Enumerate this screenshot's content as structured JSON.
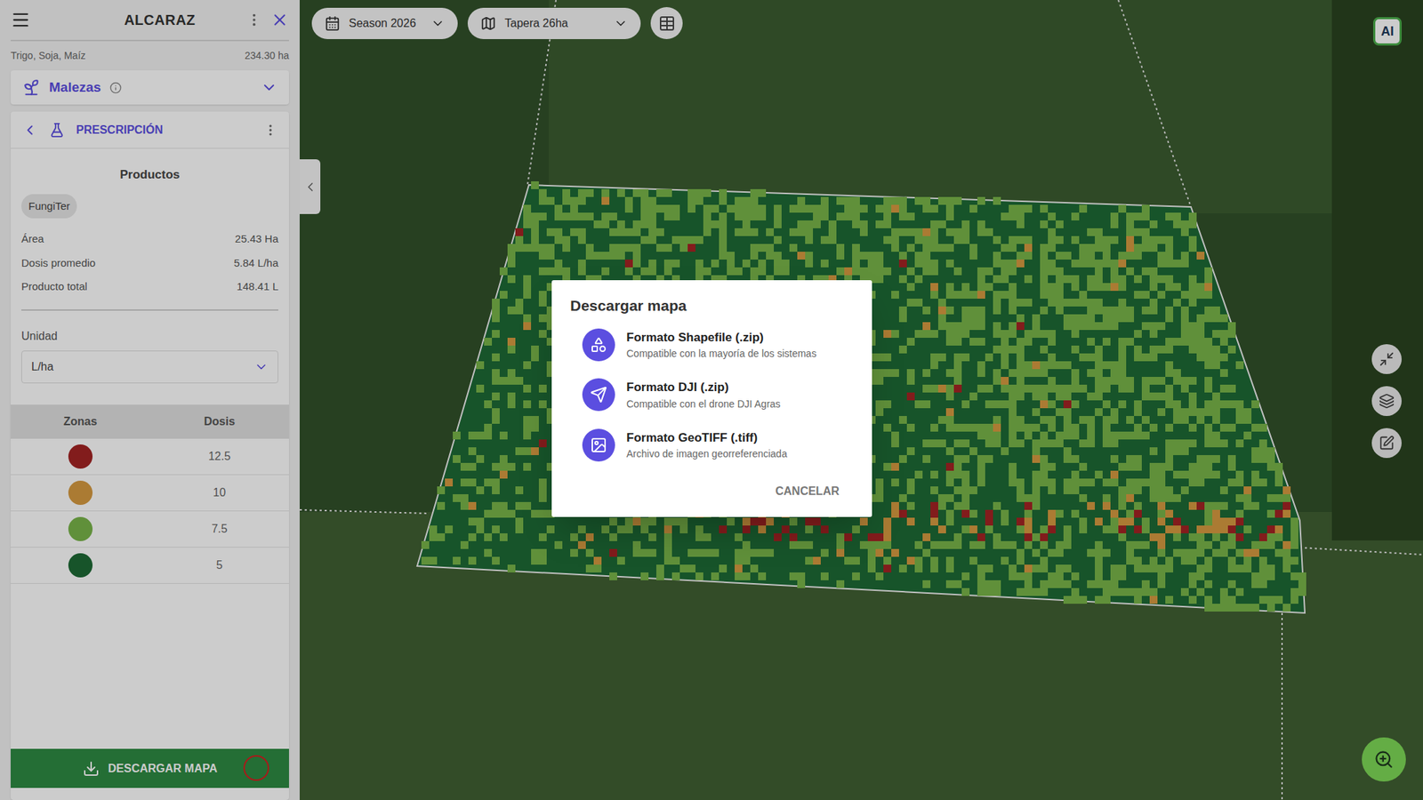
{
  "sidebar": {
    "title": "ALCARAZ",
    "crops": "Trigo, Soja, Maíz",
    "total_area": "234.30 ha",
    "layer": {
      "label": "Malezas",
      "expanded": false
    },
    "prescription": {
      "title": "PRESCRIPCIÓN",
      "products_heading": "Productos",
      "products": [
        {
          "label": "FungiTer"
        }
      ],
      "stats": [
        {
          "label": "Área",
          "value": "25.43 Ha"
        },
        {
          "label": "Dosis promedio",
          "value": "5.84 L/ha"
        },
        {
          "label": "Producto total",
          "value": "148.41 L"
        }
      ],
      "unit": {
        "label": "Unidad",
        "value": "L/ha"
      },
      "zones_table": {
        "columns": [
          "Zonas",
          "Dosis"
        ],
        "rows": [
          {
            "color": "#a32424",
            "dose": "12.5"
          },
          {
            "color": "#d69a40",
            "dose": "10"
          },
          {
            "color": "#78b449",
            "dose": "7.5"
          },
          {
            "color": "#1d6a35",
            "dose": "5"
          }
        ]
      },
      "download_button": {
        "label": "DESCARGAR MAPA",
        "highlighted": true
      }
    }
  },
  "toolbar": {
    "season": "Season 2026",
    "field": "Tapera 26ha"
  },
  "ai_badge": "AI",
  "dialog": {
    "title": "Descargar mapa",
    "options": [
      {
        "title": "Formato Shapefile (.zip)",
        "subtitle": "Compatible con la mayoría de los sistemas"
      },
      {
        "title": "Formato DJI (.zip)",
        "subtitle": "Compatible con el drone DJI Agras"
      },
      {
        "title": "Formato GeoTIFF (.tiff)",
        "subtitle": "Archivo de imagen georreferenciada"
      }
    ],
    "cancel": "CANCELAR"
  }
}
